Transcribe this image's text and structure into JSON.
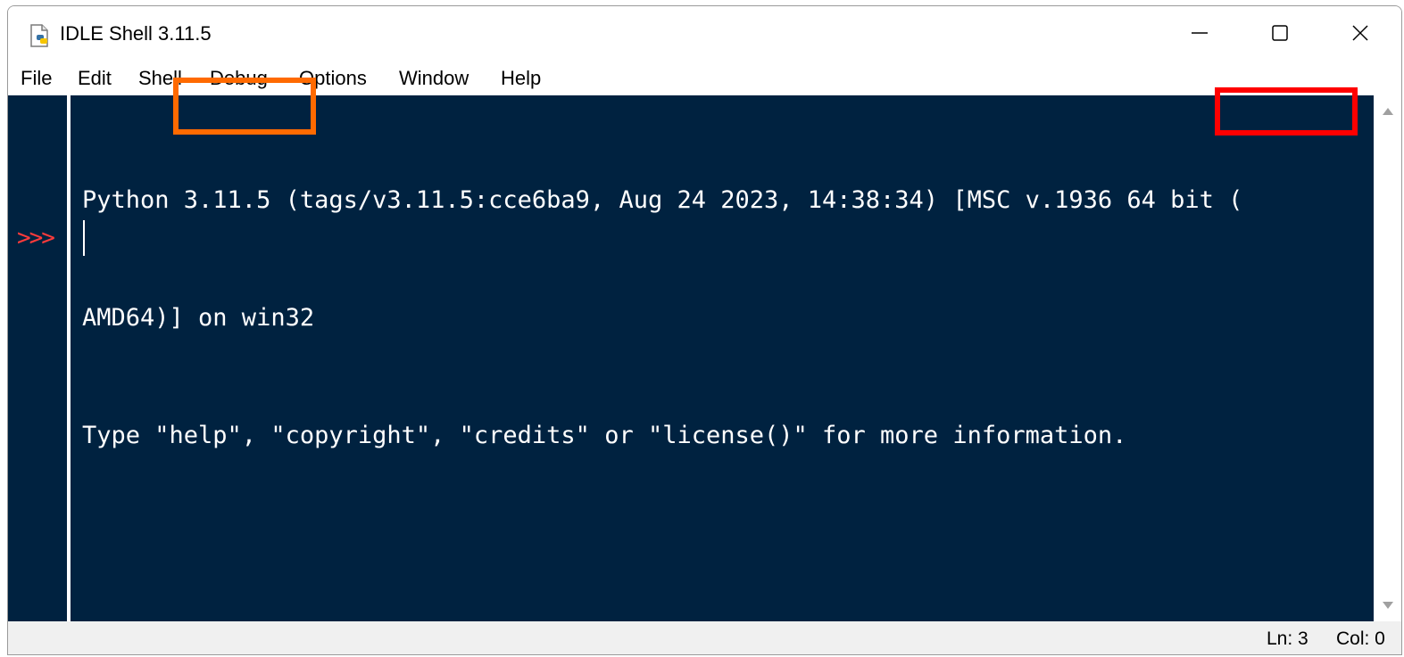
{
  "window": {
    "title": "IDLE Shell 3.11.5"
  },
  "titlebar": {
    "app_icon": "python-file-icon",
    "minimize_icon": "minimize-icon",
    "maximize_icon": "maximize-icon",
    "close_icon": "close-icon"
  },
  "menubar": {
    "items": [
      {
        "label": "File"
      },
      {
        "label": "Edit"
      },
      {
        "label": "Shell"
      },
      {
        "label": "Debug"
      },
      {
        "label": "Options"
      },
      {
        "label": "Window"
      },
      {
        "label": "Help"
      }
    ]
  },
  "shell": {
    "lines": [
      "Python 3.11.5 (tags/v3.11.5:cce6ba9, Aug 24 2023, 14:38:34) [MSC v.1936 64 bit (",
      "AMD64)] on win32",
      "Type \"help\", \"copyright\", \"credits\" or \"license()\" for more information."
    ],
    "prompt": ">>>"
  },
  "statusbar": {
    "line": "Ln: 3",
    "col": "Col: 0"
  },
  "colors": {
    "editor_background": "#002240",
    "text": "#ffffff",
    "prompt": "#ff3b3b",
    "highlight_version": "#ff6a00",
    "highlight_bits": "#ff0000"
  }
}
